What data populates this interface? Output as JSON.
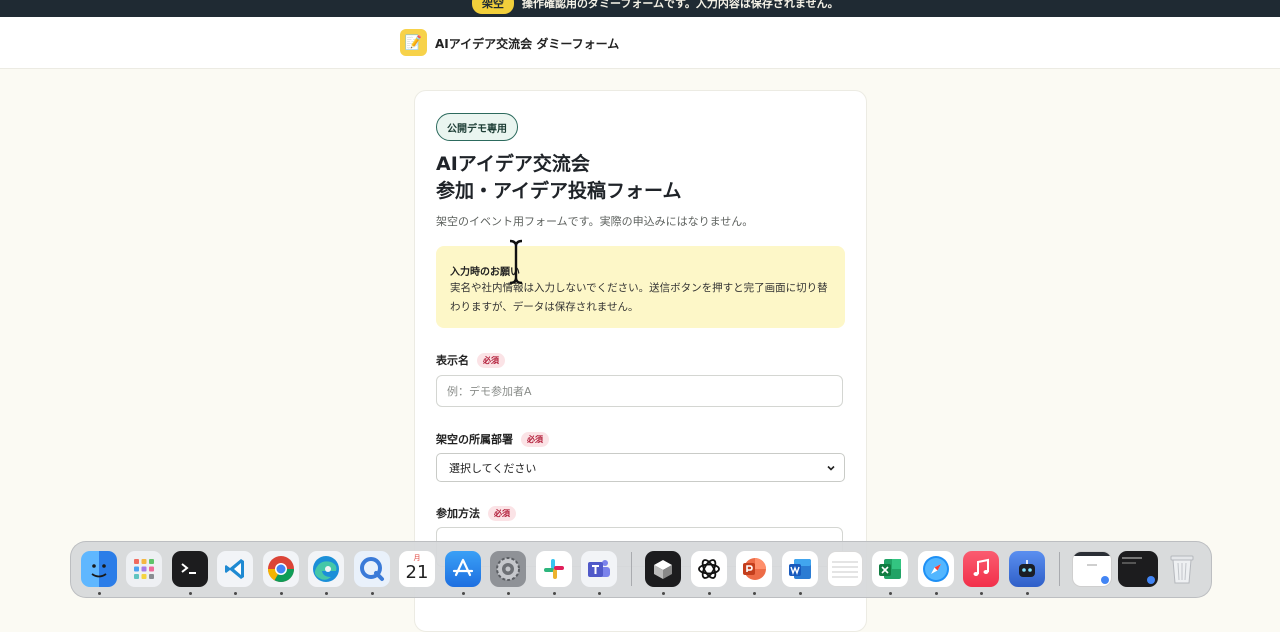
{
  "banner": {
    "badge": "架空",
    "text": "操作確認用のダミーフォームです。入力内容は保存されません。"
  },
  "header": {
    "logo_glyph": "📝",
    "site_title": "AIアイデア交流会 ダミーフォーム"
  },
  "form": {
    "tag": "公開デモ専用",
    "title_line1": "AIアイデア交流会",
    "title_line2": "参加・アイデア投稿フォーム",
    "subtitle": "架空のイベント用フォームです。実際の申込みにはなりません。",
    "notice": {
      "heading": "入力時のお願い",
      "body": "実名や社内情報は入力しないでください。送信ボタンを押すと完了画面に切り替わりますが、データは保存されません。"
    },
    "required_badge": "必須",
    "fields": {
      "display_name": {
        "label": "表示名",
        "placeholder": "例：デモ参加者A"
      },
      "department": {
        "label": "架空の所属部署",
        "selected": "選択してください"
      },
      "participation": {
        "label": "参加方法"
      }
    }
  },
  "dock": {
    "calendar_month": "月",
    "calendar_day": "21",
    "apps": [
      {
        "name": "finder-icon",
        "bg": "#3d8cf0"
      },
      {
        "name": "launchpad-icon",
        "bg": "#eef0f3"
      },
      {
        "name": "terminal-icon",
        "bg": "#1c1c1e"
      },
      {
        "name": "vscode-icon",
        "bg": "#f2f4f7"
      },
      {
        "name": "chrome-icon",
        "bg": "#f2f4f7"
      },
      {
        "name": "edge-icon",
        "bg": "#f2f4f7"
      },
      {
        "name": "quicktime-icon",
        "bg": "#e9f1fb"
      },
      {
        "name": "calendar-icon",
        "bg": "#ffffff"
      },
      {
        "name": "app-store-icon",
        "bg": "#2f86f0"
      },
      {
        "name": "system-settings-icon",
        "bg": "#8f9297"
      },
      {
        "name": "slack-icon",
        "bg": "#ffffff"
      },
      {
        "name": "teams-icon",
        "bg": "#f2f4f7"
      },
      {
        "name": "box-app-icon",
        "bg": "#1c1c1e"
      },
      {
        "name": "chatgpt-icon",
        "bg": "#ffffff"
      },
      {
        "name": "powerpoint-icon",
        "bg": "#ffffff"
      },
      {
        "name": "word-icon",
        "bg": "#ffffff"
      },
      {
        "name": "notes-icon",
        "bg": "#ffffff"
      },
      {
        "name": "excel-icon",
        "bg": "#ffffff"
      },
      {
        "name": "safari-icon",
        "bg": "#ffffff"
      },
      {
        "name": "music-icon",
        "bg": "#f6435b"
      },
      {
        "name": "robot-app-icon",
        "bg": "#3a6fd8"
      },
      {
        "name": "window-thumbnail-1",
        "bg": "#ffffff"
      },
      {
        "name": "window-thumbnail-2",
        "bg": "#1c1c1e"
      },
      {
        "name": "trash-icon",
        "bg": "transparent"
      }
    ]
  }
}
